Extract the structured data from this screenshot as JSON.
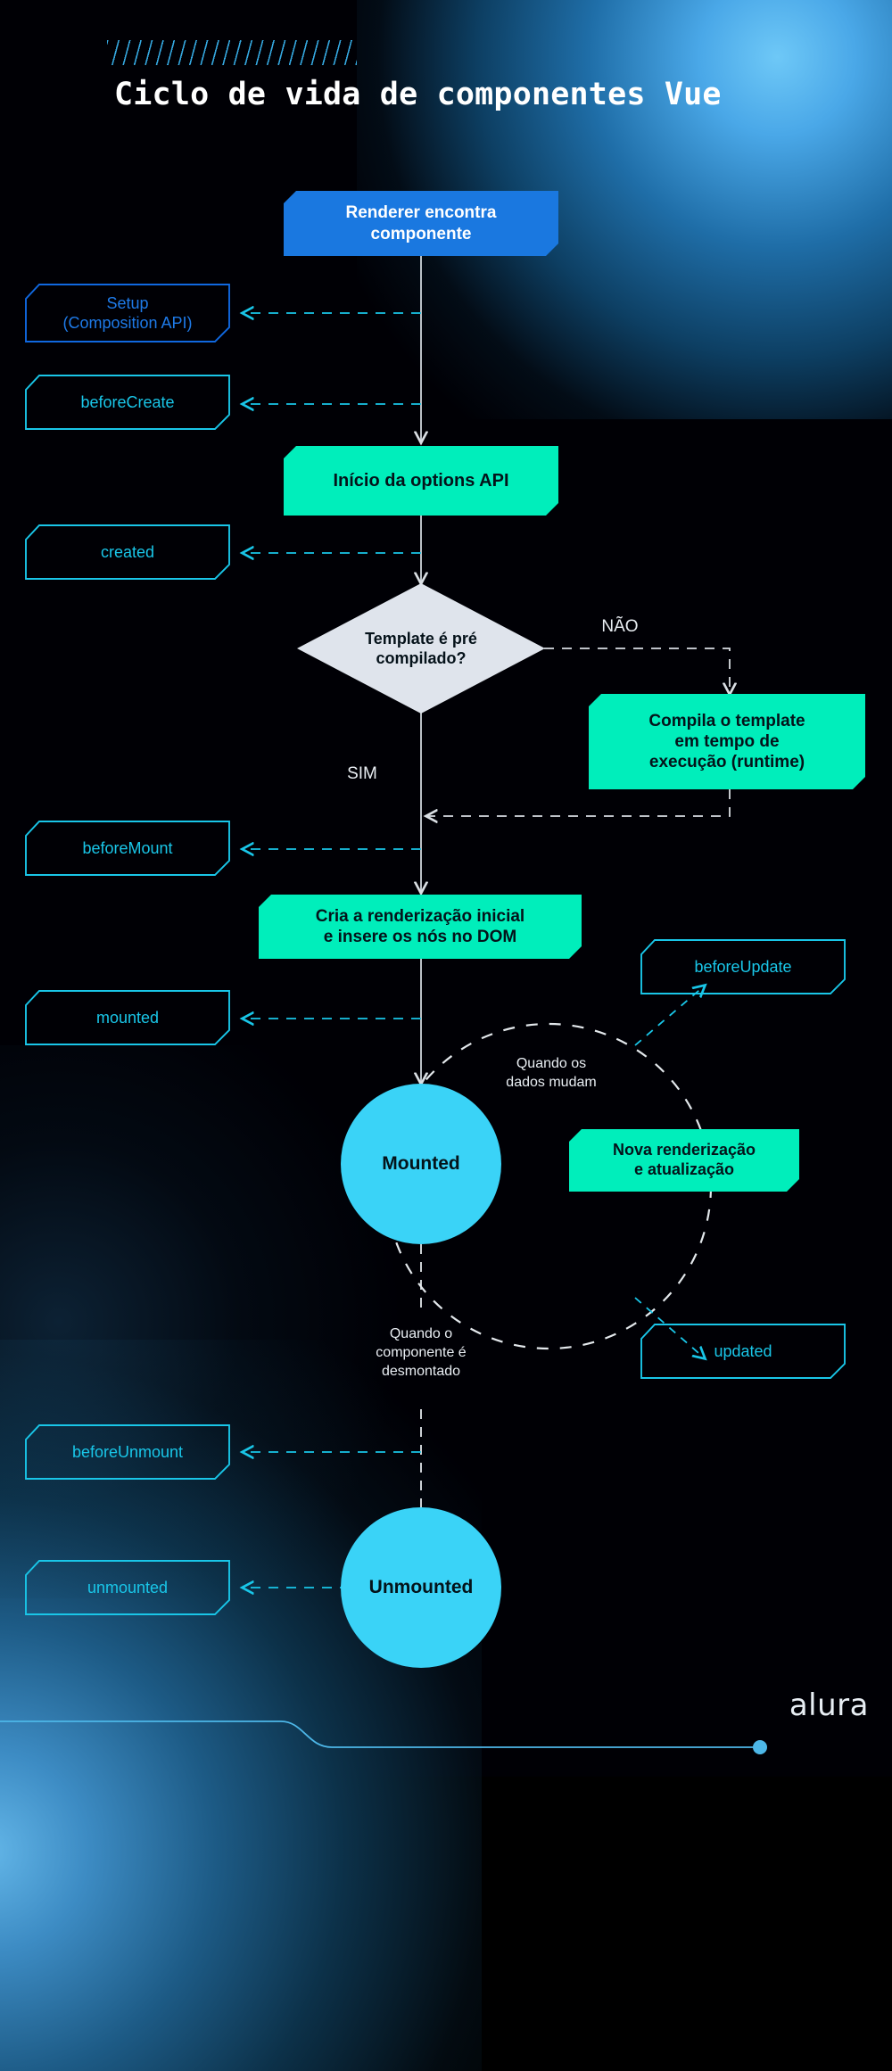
{
  "header": {
    "title": "Ciclo de vida de componentes Vue",
    "hatch_decoration": "diagonal-stripes"
  },
  "brand": {
    "logo_text": "alura"
  },
  "colors": {
    "background": "#000005",
    "accent_cyan": "#19c6e8",
    "accent_blue": "#1a78e0",
    "accent_green": "#00eebb",
    "circle_blue": "#3ad3f7",
    "diamond_gray": "#dfe4ec",
    "text_light": "#e9eef3"
  },
  "chart_data": {
    "type": "diagram",
    "title": "Ciclo de vida de componentes Vue",
    "nodes": [
      {
        "id": "renderer",
        "label": "Renderer encontra componente",
        "shape": "process",
        "style": "solid-blue"
      },
      {
        "id": "setup",
        "label": "Setup (Composition API)",
        "shape": "hook",
        "style": "outline-blue"
      },
      {
        "id": "beforeCreate",
        "label": "beforeCreate",
        "shape": "hook",
        "style": "outline-cyan"
      },
      {
        "id": "optionsapi",
        "label": "Início da options API",
        "shape": "process",
        "style": "solid-green"
      },
      {
        "id": "created",
        "label": "created",
        "shape": "hook",
        "style": "outline-cyan"
      },
      {
        "id": "decision",
        "label": "Template é pré compilado?",
        "shape": "diamond",
        "style": "gray"
      },
      {
        "id": "compile",
        "label": "Compila o template em tempo de execução (runtime)",
        "shape": "process",
        "style": "solid-green"
      },
      {
        "id": "beforeMount",
        "label": "beforeMount",
        "shape": "hook",
        "style": "outline-cyan"
      },
      {
        "id": "render",
        "label": "Cria a renderização inicial e insere os nós no DOM",
        "shape": "process",
        "style": "solid-green"
      },
      {
        "id": "mounted",
        "label": "mounted",
        "shape": "hook",
        "style": "outline-cyan"
      },
      {
        "id": "beforeUpdate",
        "label": "beforeUpdate",
        "shape": "hook",
        "style": "outline-cyan"
      },
      {
        "id": "mountedState",
        "label": "Mounted",
        "shape": "circle",
        "style": "circle-blue"
      },
      {
        "id": "rerender",
        "label": "Nova renderização e atualização",
        "shape": "process",
        "style": "solid-green"
      },
      {
        "id": "updated",
        "label": "updated",
        "shape": "hook",
        "style": "outline-cyan"
      },
      {
        "id": "beforeUnmount",
        "label": "beforeUnmount",
        "shape": "hook",
        "style": "outline-cyan"
      },
      {
        "id": "unmountedState",
        "label": "Unmounted",
        "shape": "circle",
        "style": "circle-blue"
      },
      {
        "id": "unmounted",
        "label": "unmounted",
        "shape": "hook",
        "style": "outline-cyan"
      }
    ],
    "edge_labels": [
      "NÃO",
      "SIM",
      "Quando os dados mudam",
      "Quando o componente é desmontado"
    ],
    "edges": [
      {
        "from": "renderer",
        "to": "setup",
        "style": "dashed"
      },
      {
        "from": "renderer",
        "to": "beforeCreate",
        "style": "dashed"
      },
      {
        "from": "renderer",
        "to": "optionsapi",
        "style": "solid"
      },
      {
        "from": "optionsapi",
        "to": "created",
        "style": "dashed"
      },
      {
        "from": "optionsapi",
        "to": "decision",
        "style": "solid"
      },
      {
        "from": "decision",
        "to": "compile",
        "style": "dashed",
        "label": "NÃO"
      },
      {
        "from": "decision",
        "to": "render",
        "style": "solid",
        "label": "SIM"
      },
      {
        "from": "compile",
        "to": "render",
        "style": "dashed"
      },
      {
        "from": "render",
        "to": "beforeMount",
        "style": "dashed"
      },
      {
        "from": "render",
        "to": "mounted",
        "style": "dashed"
      },
      {
        "from": "render",
        "to": "mountedState",
        "style": "solid"
      },
      {
        "from": "mountedState",
        "to": "rerender",
        "style": "dashed",
        "label": "Quando os dados mudam"
      },
      {
        "from": "rerender",
        "to": "beforeUpdate",
        "style": "dashed"
      },
      {
        "from": "rerender",
        "to": "updated",
        "style": "dashed"
      },
      {
        "from": "mountedState",
        "to": "unmountedState",
        "style": "dashed",
        "label": "Quando o componente é desmontado"
      },
      {
        "from": "unmountedState",
        "to": "beforeUnmount",
        "style": "dashed"
      },
      {
        "from": "unmountedState",
        "to": "unmounted",
        "style": "dashed"
      }
    ]
  },
  "nodes": {
    "renderer": {
      "line1": "Renderer encontra",
      "line2": "componente"
    },
    "setup": {
      "line1": "Setup",
      "line2": "(Composition API)"
    },
    "beforeCreate": {
      "label": "beforeCreate"
    },
    "optionsapi": {
      "label": "Início da options API"
    },
    "created": {
      "label": "created"
    },
    "decision": {
      "line1": "Template é pré",
      "line2": "compilado?"
    },
    "compile": {
      "line1": "Compila o template",
      "line2": "em tempo de",
      "line3": "execução (runtime)"
    },
    "beforeMount": {
      "label": "beforeMount"
    },
    "render": {
      "line1": "Cria a renderização inicial",
      "line2": "e insere os nós no DOM"
    },
    "mounted": {
      "label": "mounted"
    },
    "beforeUpdate": {
      "label": "beforeUpdate"
    },
    "mountedState": {
      "label": "Mounted"
    },
    "rerender": {
      "line1": "Nova renderização",
      "line2": "e atualização"
    },
    "updated": {
      "label": "updated"
    },
    "beforeUnmount": {
      "label": "beforeUnmount"
    },
    "unmountedState": {
      "label": "Unmounted"
    },
    "unmounted": {
      "label": "unmounted"
    }
  },
  "labels": {
    "nao": "NÃO",
    "sim": "SIM",
    "data_change_line1": "Quando os",
    "data_change_line2": "dados mudam",
    "unmount_line1": "Quando o",
    "unmount_line2": "componente é",
    "unmount_line3": "desmontado"
  }
}
